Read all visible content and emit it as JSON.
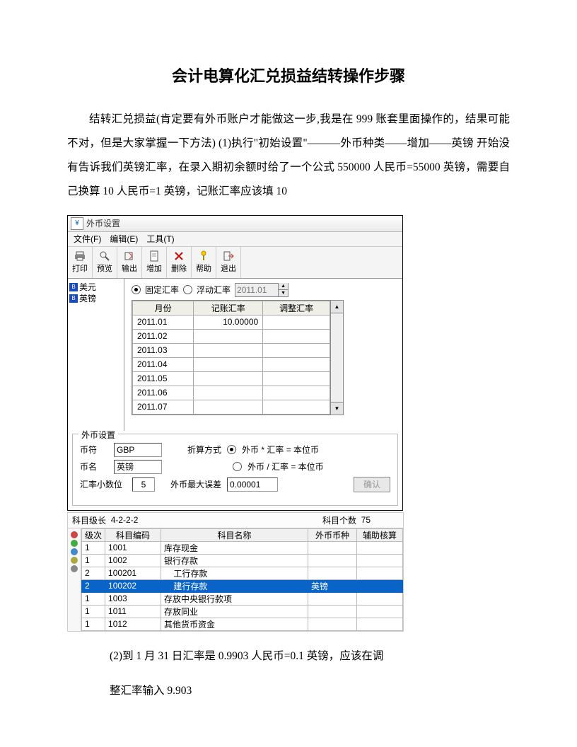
{
  "doc": {
    "title": "会计电算化汇兑损益结转操作步骤",
    "para1": "结转汇兑损益(肯定要有外币账户才能做这一步,我是在 999 账套里面操作的，结果可能不对，但是大家掌握一下方法) (1)执行\"初始设置\"———外币种类——增加——英镑 开始没有告诉我们英镑汇率，在录入期初余额时给了一个公式 550000 人民币=55000 英镑，需要自己换算 10 人民币=1 英镑，记账汇率应该填 10",
    "after1": "(2)到 1 月 31 日汇率是 0.9903 人民币=0.1 英镑，应该在调",
    "after2": "整汇率输入 9.903"
  },
  "win": {
    "title": "外币设置",
    "menus": [
      "文件(F)",
      "编辑(E)",
      "工具(T)"
    ],
    "toolbar": [
      {
        "name": "print",
        "label": "打印"
      },
      {
        "name": "preview",
        "label": "预览"
      },
      {
        "name": "export",
        "label": "输出"
      },
      {
        "name": "add",
        "label": "增加"
      },
      {
        "name": "delete",
        "label": "删除"
      },
      {
        "name": "help",
        "label": "帮助"
      },
      {
        "name": "exit",
        "label": "退出"
      }
    ],
    "tree": [
      {
        "label": "美元"
      },
      {
        "label": "英镑"
      }
    ],
    "rate_type": {
      "fixed": "固定汇率",
      "float": "浮动汇率",
      "period": "2011.01"
    },
    "grid_headers": [
      "月份",
      "记账汇率",
      "调整汇率"
    ],
    "grid_rows": [
      {
        "m": "2011.01",
        "r": "10.00000",
        "a": ""
      },
      {
        "m": "2011.02",
        "r": "",
        "a": ""
      },
      {
        "m": "2011.03",
        "r": "",
        "a": ""
      },
      {
        "m": "2011.04",
        "r": "",
        "a": ""
      },
      {
        "m": "2011.05",
        "r": "",
        "a": ""
      },
      {
        "m": "2011.06",
        "r": "",
        "a": ""
      },
      {
        "m": "2011.07",
        "r": "",
        "a": ""
      }
    ],
    "box_legend": "外币设置",
    "labels": {
      "symbol": "币符",
      "name": "币名",
      "calc": "折算方式",
      "opt1": "外币 * 汇率 = 本位币",
      "opt2": "外币 / 汇率 = 本位币",
      "dec": "汇率小数位",
      "err": "外币最大误差",
      "ok": "确认"
    },
    "vals": {
      "symbol": "GBP",
      "name": "英镑",
      "dec": "5",
      "err": "0.00001"
    }
  },
  "acc": {
    "head": {
      "l1": "科目级长",
      "l1v": "4-2-2-2",
      "l2": "科目个数",
      "l2v": "75"
    },
    "headers": {
      "lv": "级次",
      "code": "科目编码",
      "name": "科目名称",
      "cur": "外币币种",
      "aux": "辅助核算"
    },
    "rows": [
      {
        "lv": "1",
        "code": "1001",
        "name": "库存现金",
        "cur": "",
        "aux": ""
      },
      {
        "lv": "1",
        "code": "1002",
        "name": "银行存款",
        "cur": "",
        "aux": ""
      },
      {
        "lv": "2",
        "code": "100201",
        "name": "工行存款",
        "cur": "",
        "aux": ""
      },
      {
        "lv": "2",
        "code": "100202",
        "name": "建行存款",
        "cur": "英镑",
        "aux": "",
        "sel": true
      },
      {
        "lv": "1",
        "code": "1003",
        "name": "存放中央银行款项",
        "cur": "",
        "aux": ""
      },
      {
        "lv": "1",
        "code": "1011",
        "name": "存放同业",
        "cur": "",
        "aux": ""
      },
      {
        "lv": "1",
        "code": "1012",
        "name": "其他货币资金",
        "cur": "",
        "aux": ""
      }
    ]
  }
}
